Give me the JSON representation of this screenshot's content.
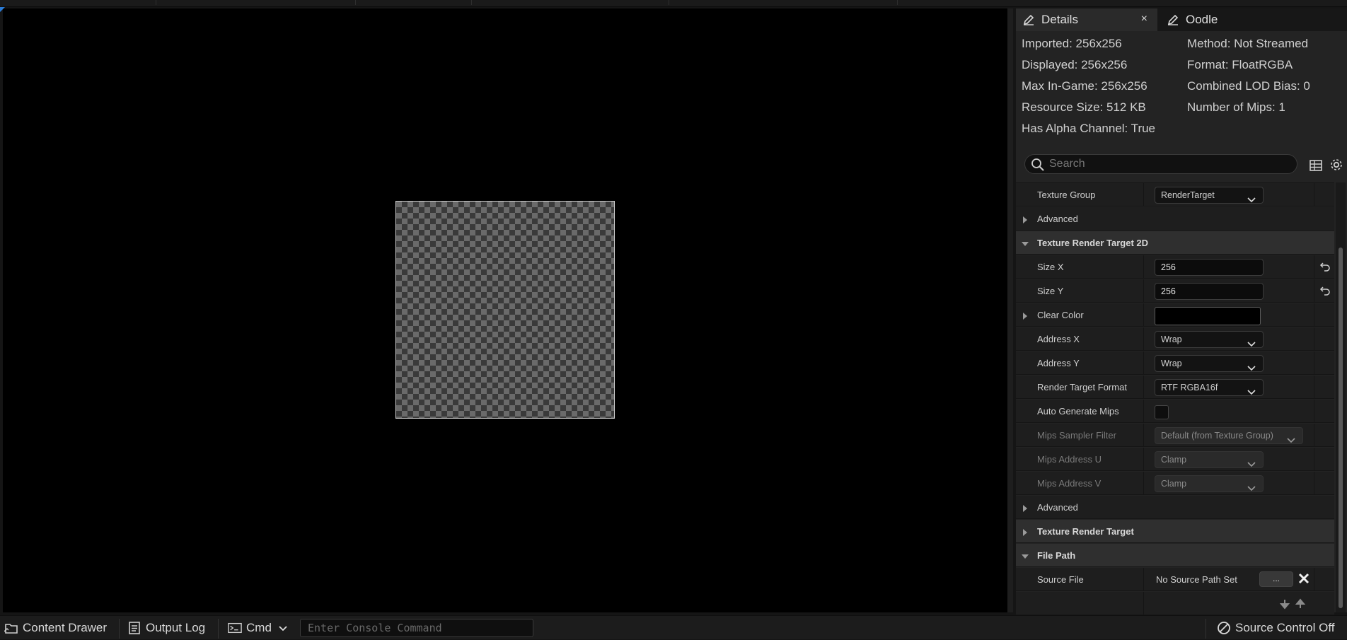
{
  "viewport": {},
  "details_panel": {
    "tabs": [
      {
        "label": "Details",
        "icon": "pencil-icon",
        "active": true
      },
      {
        "label": "Oodle",
        "icon": "pencil-icon",
        "active": false
      }
    ],
    "close_label": "×",
    "stats_left": [
      "Imported: 256x256",
      "Displayed: 256x256",
      "Max In-Game: 256x256",
      "Resource Size: 512 KB",
      "Has Alpha Channel: True"
    ],
    "stats_right": [
      "Method: Not Streamed",
      "Format: FloatRGBA",
      "Combined LOD Bias: 0",
      "Number of Mips: 1"
    ],
    "search": {
      "placeholder": "Search",
      "value": ""
    },
    "properties": {
      "texture_group": {
        "label": "Texture Group",
        "value": "RenderTarget"
      },
      "advanced_1": {
        "label": "Advanced"
      },
      "section_trt2d": {
        "label": "Texture Render Target 2D"
      },
      "size_x": {
        "label": "Size X",
        "value": "256"
      },
      "size_y": {
        "label": "Size Y",
        "value": "256"
      },
      "clear_color": {
        "label": "Clear Color",
        "value": "#000000"
      },
      "address_x": {
        "label": "Address X",
        "value": "Wrap"
      },
      "address_y": {
        "label": "Address Y",
        "value": "Wrap"
      },
      "rt_format": {
        "label": "Render Target Format",
        "value": "RTF RGBA16f"
      },
      "auto_mips": {
        "label": "Auto Generate Mips",
        "checked": false
      },
      "mips_sampler": {
        "label": "Mips Sampler Filter",
        "value": "Default (from Texture Group)"
      },
      "mips_u": {
        "label": "Mips Address U",
        "value": "Clamp"
      },
      "mips_v": {
        "label": "Mips Address V",
        "value": "Clamp"
      },
      "advanced_2": {
        "label": "Advanced"
      },
      "section_trt": {
        "label": "Texture Render Target"
      },
      "section_filepath": {
        "label": "File Path"
      },
      "source_file": {
        "label": "Source File",
        "value": "No Source Path Set",
        "browse": "..."
      }
    }
  },
  "status_bar": {
    "content_drawer": "Content Drawer",
    "output_log": "Output Log",
    "cmd": "Cmd",
    "console_placeholder": "Enter Console Command",
    "source_control": "Source Control Off"
  },
  "colors": {
    "accent": "#2a7bd6",
    "panel_bg": "#232323",
    "row_bg": "#1e1e1e",
    "header_bg": "#2f2f2f"
  }
}
